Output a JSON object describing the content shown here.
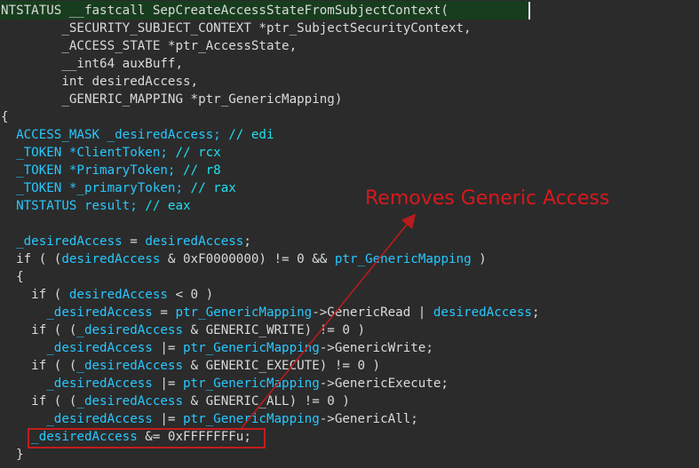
{
  "code": {
    "l1": "NTSTATUS __fastcall SepCreateAccessStateFromSubjectContext(",
    "l2": "        _SECURITY_SUBJECT_CONTEXT *ptr_SubjectSecurityContext,",
    "l3": "        _ACCESS_STATE *ptr_AccessState,",
    "l4": "        __int64 auxBuff,",
    "l5": "        int desiredAccess,",
    "l6": "        _GENERIC_MAPPING *ptr_GenericMapping)",
    "l7": "{",
    "l8a": "  ACCESS_MASK _desiredAccess; ",
    "l8b": "// edi",
    "l9a": "  _TOKEN *ClientToken; ",
    "l9b": "// rcx",
    "l10a": "  _TOKEN *PrimaryToken; ",
    "l10b": "// r8",
    "l11a": "  _TOKEN *_primaryToken; ",
    "l11b": "// rax",
    "l12a": "  NTSTATUS result; ",
    "l12b": "// eax",
    "l14a": "  ",
    "l14b": "_desiredAccess",
    "l14c": " = ",
    "l14d": "desiredAccess",
    "l14e": ";",
    "l15a": "  if ( (",
    "l15b": "desiredAccess",
    "l15c": " & 0xF0000000) != 0 && ",
    "l15d": "ptr_GenericMapping",
    "l15e": " )",
    "l16": "  {",
    "l17a": "    if ( ",
    "l17b": "desiredAccess",
    "l17c": " < 0 )",
    "l18a": "      ",
    "l18b": "_desiredAccess",
    "l18c": " = ",
    "l18d": "ptr_GenericMapping",
    "l18e": "->GenericRead | ",
    "l18f": "desiredAccess",
    "l18g": ";",
    "l19a": "    if ( (",
    "l19b": "_desiredAccess",
    "l19c": " & GENERIC_WRITE) != 0 )",
    "l20a": "      ",
    "l20b": "_desiredAccess",
    "l20c": " |= ",
    "l20d": "ptr_GenericMapping",
    "l20e": "->GenericWrite;",
    "l21a": "    if ( (",
    "l21b": "_desiredAccess",
    "l21c": " & GENERIC_EXECUTE) != 0 )",
    "l22a": "      ",
    "l22b": "_desiredAccess",
    "l22c": " |= ",
    "l22d": "ptr_GenericMapping",
    "l22e": "->GenericExecute;",
    "l23a": "    if ( (",
    "l23b": "_desiredAccess",
    "l23c": " & GENERIC_ALL) != 0 )",
    "l24a": "      ",
    "l24b": "_desiredAccess",
    "l24c": " |= ",
    "l24d": "ptr_GenericMapping",
    "l24e": "->GenericAll;",
    "l25a": "    ",
    "l25b": "_desiredAccess",
    "l25c": " &= 0xFFFFFFFu;",
    "l26": "  }"
  },
  "annotation": "Removes Generic Access",
  "colors": {
    "background": "#2b2b2b",
    "text": "#dadada",
    "variable": "#28c8ff",
    "comment": "#1ee0ee",
    "annotation": "#d7191c",
    "line_highlight": "#183d1e"
  }
}
